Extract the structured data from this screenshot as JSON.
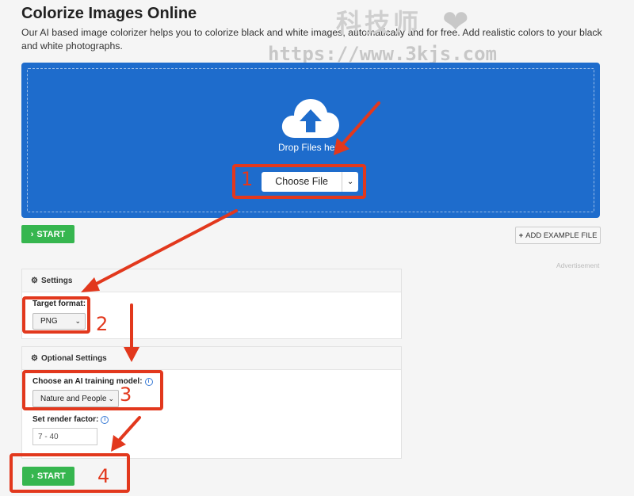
{
  "page": {
    "title": "Colorize Images Online",
    "description": "Our AI based image colorizer helps you to colorize black and white images, automatically and for free. Add realistic colors to your black and white photographs."
  },
  "watermark": {
    "text": "科技师",
    "url": "https://www.3kjs.com",
    "heart_icon": "heart-icon"
  },
  "dropzone": {
    "drop_text": "Drop Files here",
    "choose_label": "Choose File",
    "icon": "cloud-upload-icon",
    "color": "#1e6ccc"
  },
  "actions": {
    "start_label": "START",
    "add_example_label": "ADD EXAMPLE FILE",
    "advertisement_label": "Advertisement",
    "start_color": "#36b64f"
  },
  "settings": {
    "header": "Settings",
    "target_format_label": "Target format:",
    "target_format_value": "PNG"
  },
  "optional_settings": {
    "header": "Optional Settings",
    "model_label": "Choose an AI training model:",
    "model_value": "Nature and People",
    "render_label": "Set render factor:",
    "render_placeholder": "7 - 40"
  },
  "annotations": {
    "color": "#e2381d",
    "markers": [
      "1",
      "2",
      "3",
      "4"
    ]
  }
}
